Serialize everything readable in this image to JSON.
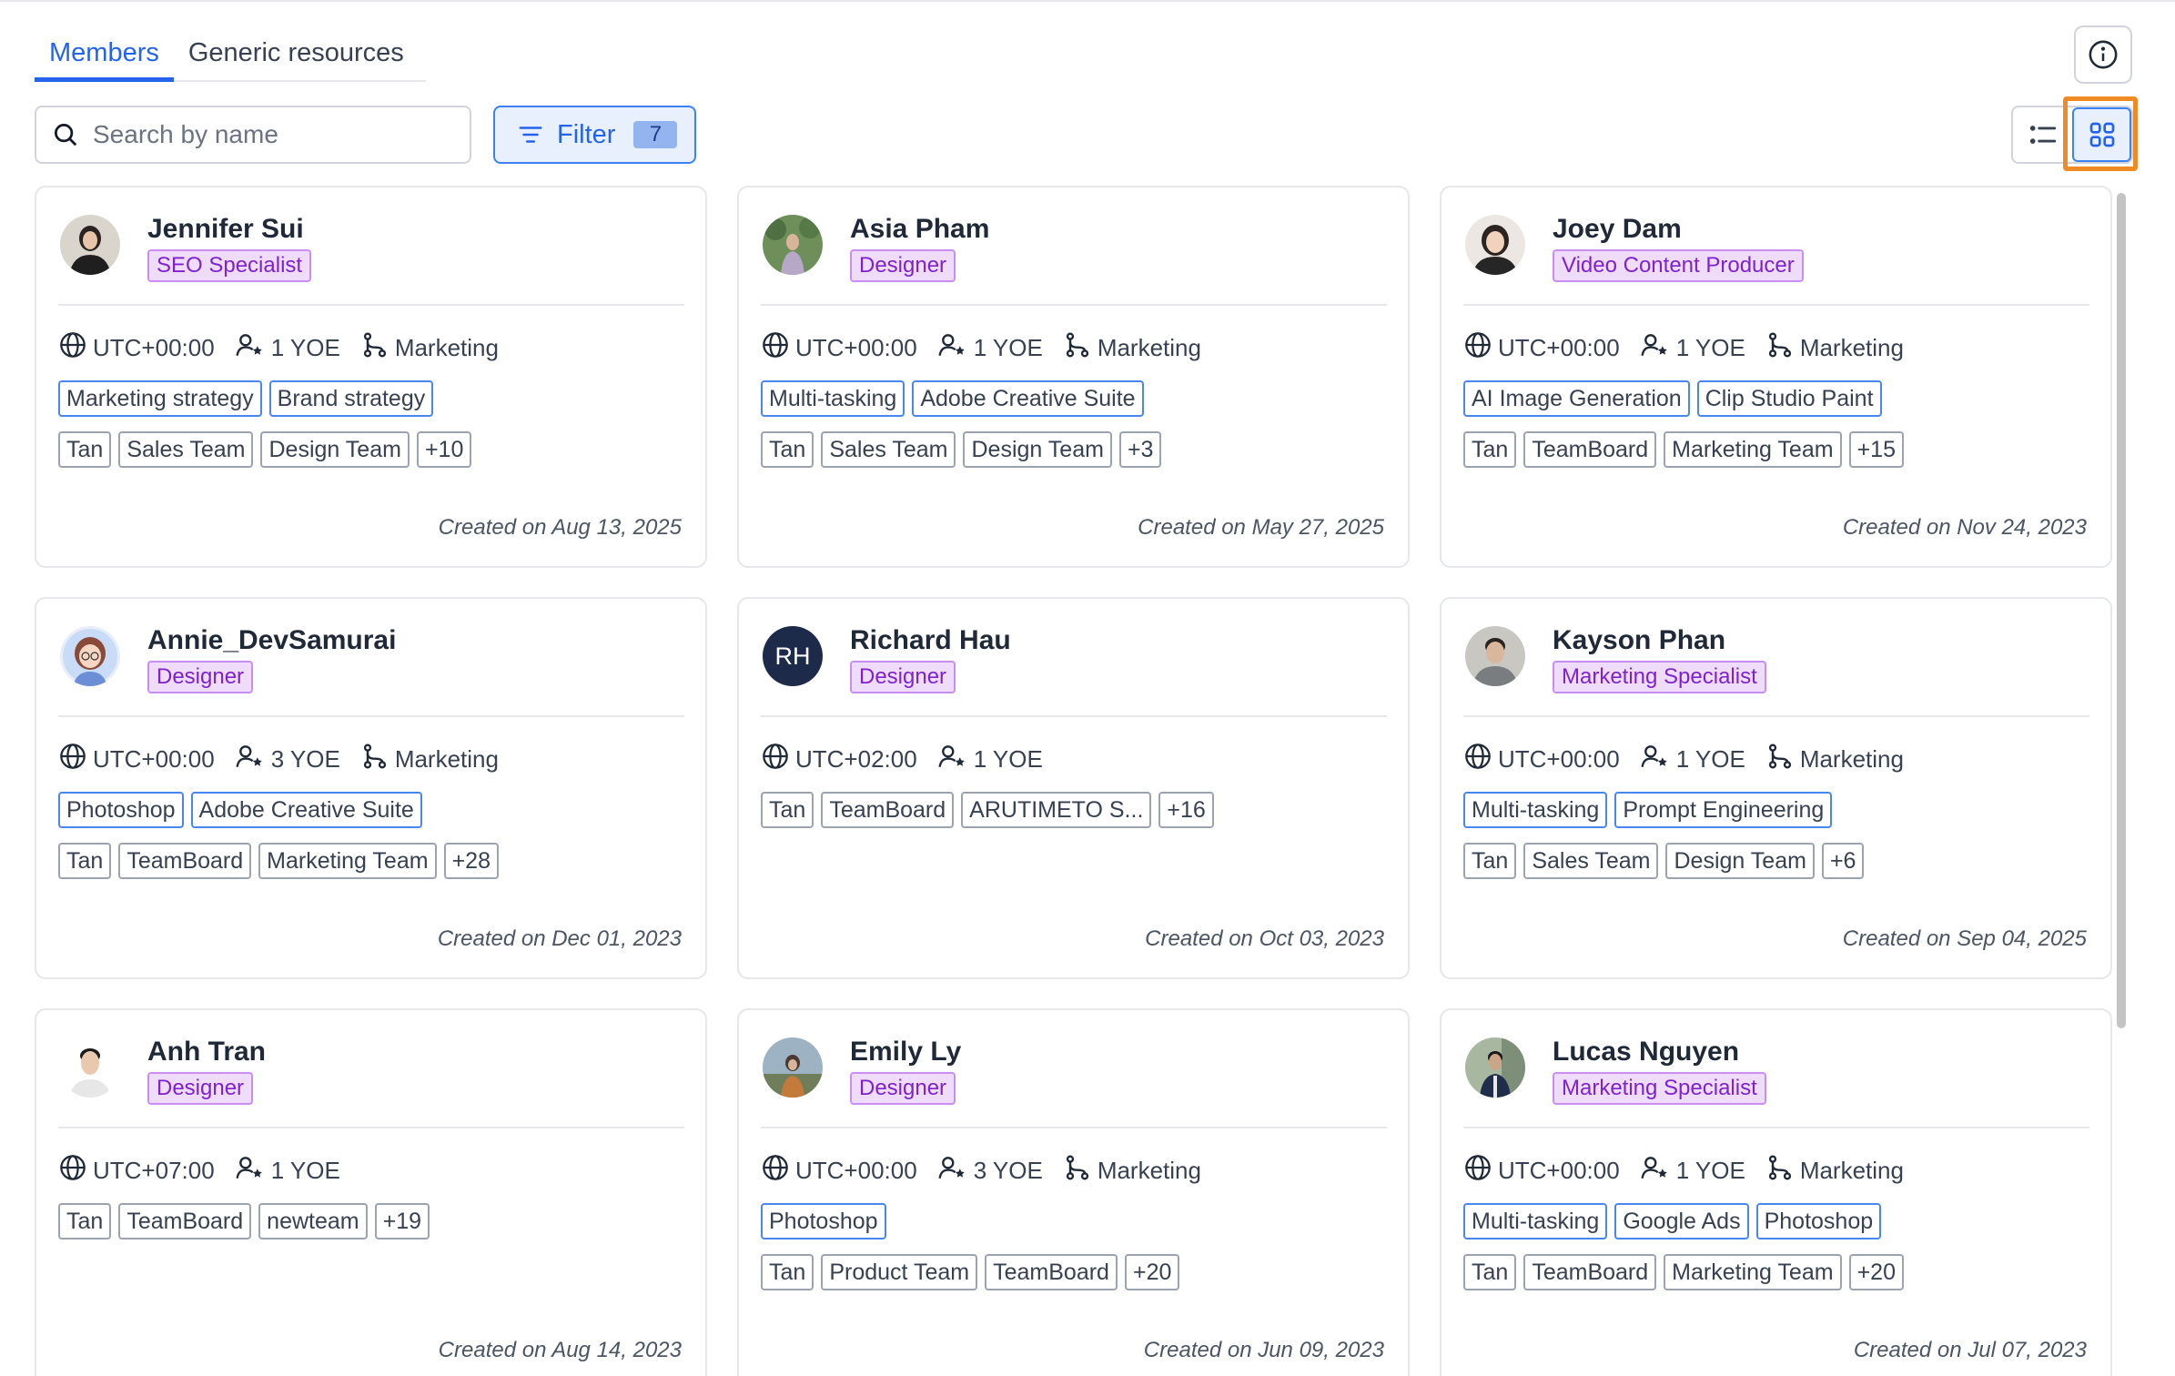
{
  "tabs": {
    "members": "Members",
    "generic": "Generic resources"
  },
  "search": {
    "placeholder": "Search by name"
  },
  "filter": {
    "label": "Filter",
    "count": "7"
  },
  "icons": {
    "info": "info-icon",
    "search": "search-icon",
    "filter": "filter-lines-icon",
    "list_view": "list-view-icon",
    "grid_view": "grid-view-icon",
    "timezone": "globe-icon",
    "yoe": "user-star-icon",
    "department": "branch-icon"
  },
  "colors": {
    "accent": "#2563eb",
    "role_bg": "#efdcfb",
    "role_text": "#7e22ce",
    "highlight": "#f08a24"
  },
  "members": [
    {
      "name": "Jennifer Sui",
      "role": "SEO Specialist",
      "tz": "UTC+00:00",
      "yoe": "1 YOE",
      "dept": "Marketing",
      "skills": [
        "Marketing strategy",
        "Brand strategy"
      ],
      "teams": [
        "Tan",
        "Sales Team",
        "Design Team",
        "+10"
      ],
      "created": "Created on Aug 13, 2025"
    },
    {
      "name": "Asia Pham",
      "role": "Designer",
      "tz": "UTC+00:00",
      "yoe": "1 YOE",
      "dept": "Marketing",
      "skills": [
        "Multi-tasking",
        "Adobe Creative Suite"
      ],
      "teams": [
        "Tan",
        "Sales Team",
        "Design Team",
        "+3"
      ],
      "created": "Created on May 27, 2025"
    },
    {
      "name": "Joey Dam",
      "role": "Video Content Producer",
      "tz": "UTC+00:00",
      "yoe": "1 YOE",
      "dept": "Marketing",
      "skills": [
        "AI Image Generation",
        "Clip Studio Paint"
      ],
      "teams": [
        "Tan",
        "TeamBoard",
        "Marketing Team",
        "+15"
      ],
      "created": "Created on Nov 24, 2023"
    },
    {
      "name": "Annie_DevSamurai",
      "role": "Designer",
      "tz": "UTC+00:00",
      "yoe": "3 YOE",
      "dept": "Marketing",
      "skills": [
        "Photoshop",
        "Adobe Creative Suite"
      ],
      "teams": [
        "Tan",
        "TeamBoard",
        "Marketing Team",
        "+28"
      ],
      "created": "Created on Dec 01, 2023"
    },
    {
      "name": "Richard Hau",
      "initials": "RH",
      "role": "Designer",
      "tz": "UTC+02:00",
      "yoe": "1 YOE",
      "dept": "",
      "skills": [],
      "teams": [
        "Tan",
        "TeamBoard",
        "ARUTIMETO S...",
        "+16"
      ],
      "created": "Created on Oct 03, 2023"
    },
    {
      "name": "Kayson Phan",
      "role": "Marketing Specialist",
      "tz": "UTC+00:00",
      "yoe": "1 YOE",
      "dept": "Marketing",
      "skills": [
        "Multi-tasking",
        "Prompt Engineering"
      ],
      "teams": [
        "Tan",
        "Sales Team",
        "Design Team",
        "+6"
      ],
      "created": "Created on Sep 04, 2025"
    },
    {
      "name": "Anh Tran",
      "role": "Designer",
      "tz": "UTC+07:00",
      "yoe": "1 YOE",
      "dept": "",
      "skills": [],
      "teams": [
        "Tan",
        "TeamBoard",
        "newteam",
        "+19"
      ],
      "created": "Created on Aug 14, 2023"
    },
    {
      "name": "Emily Ly",
      "role": "Designer",
      "tz": "UTC+00:00",
      "yoe": "3 YOE",
      "dept": "Marketing",
      "skills": [
        "Photoshop"
      ],
      "teams": [
        "Tan",
        "Product Team",
        "TeamBoard",
        "+20"
      ],
      "created": "Created on Jun 09, 2023"
    },
    {
      "name": "Lucas Nguyen",
      "role": "Marketing Specialist",
      "tz": "UTC+00:00",
      "yoe": "1 YOE",
      "dept": "Marketing",
      "skills": [
        "Multi-tasking",
        "Google Ads",
        "Photoshop"
      ],
      "teams": [
        "Tan",
        "TeamBoard",
        "Marketing Team",
        "+20"
      ],
      "created": "Created on Jul 07, 2023"
    }
  ]
}
